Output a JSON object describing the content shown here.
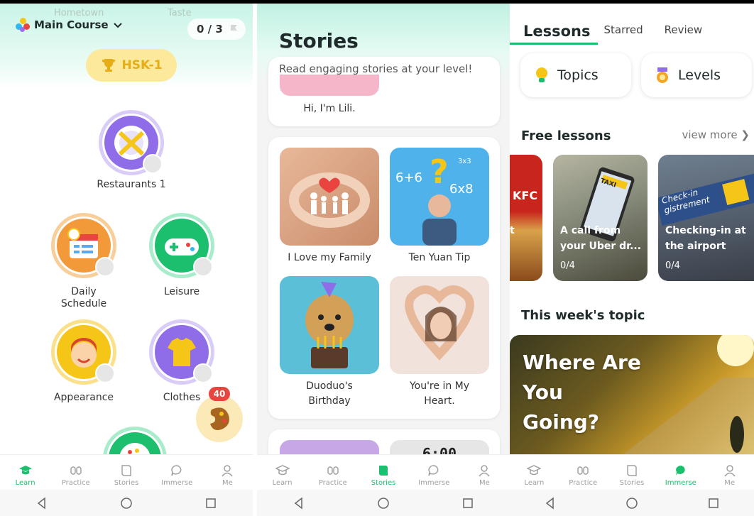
{
  "learn": {
    "ghost_left": "Hometown",
    "ghost_right": "Taste",
    "course_label": "Main Course",
    "progress": "0 / 3",
    "level_badge": "HSK-1",
    "lessons": [
      {
        "label": "Restaurants 1"
      },
      {
        "label": "Daily\nSchedule"
      },
      {
        "label": "Leisure"
      },
      {
        "label": "Appearance"
      },
      {
        "label": "Clothes"
      }
    ],
    "notification_count": "40"
  },
  "stories": {
    "title": "Stories",
    "subtitle": "Read engaging stories at your level!",
    "partial_story": "Hi, I'm Lili.",
    "items": [
      {
        "title": "I Love my Family"
      },
      {
        "title": "Ten Yuan Tip"
      },
      {
        "title": "Duoduo's\nBirthday"
      },
      {
        "title": "You're in My\nHeart."
      }
    ],
    "clock_text": "6:00"
  },
  "immerse": {
    "tabs": [
      "Lessons",
      "Starred",
      "Review"
    ],
    "buttons": [
      "Topics",
      "Levels"
    ],
    "free_lessons_title": "Free lessons",
    "view_more": "view more ❯",
    "free_lessons": [
      {
        "caption": "t",
        "brand": "KFC"
      },
      {
        "caption": "A call from\nyour Uber dr...",
        "count": "0/4",
        "sign": "TAXI"
      },
      {
        "caption": "Checking-in at\nthe airport",
        "count": "0/4",
        "sign": "Check-in\ngistrement"
      }
    ],
    "week_topic_title": "This week's topic",
    "hero_title": "Where Are You\nGoing?"
  },
  "nav": {
    "items": [
      "Learn",
      "Practice",
      "Stories",
      "Immerse",
      "Me"
    ]
  },
  "colors": {
    "accent": "#1cbf6e",
    "badge": "#e9443f",
    "hsk": "#e6ad15"
  }
}
